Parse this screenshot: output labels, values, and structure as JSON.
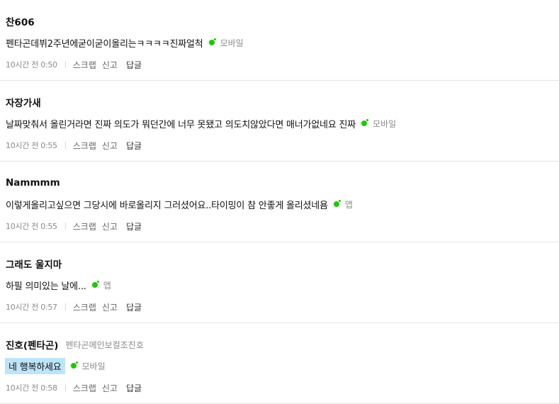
{
  "comments": [
    {
      "author": "찬606",
      "author_sub": "",
      "text": "펜타곤데뷔2주년에굳이굳이올리는ㅋㅋㅋㅋ진짜얼척",
      "highlight": false,
      "device": "모바일",
      "timestamp": "10시간 전 0:50",
      "actions": {
        "scrap": "스크랩",
        "report": "신고",
        "reply": "답글"
      }
    },
    {
      "author": "자장가새",
      "author_sub": "",
      "text": "날짜맞춰서 올린거라면 진짜 의도가 뭐던간에 너무 못됐고 의도치않았다면 매너가없네요 진짜",
      "highlight": false,
      "device": "모바일",
      "timestamp": "10시간 전 0:55",
      "actions": {
        "scrap": "스크랩",
        "report": "신고",
        "reply": "답글"
      }
    },
    {
      "author": "Nammmm",
      "author_sub": "",
      "text": "이렇게올리고싶으면 그당시에 바로올리지 그러셨어요..타이밍이 참 안좋게 올리셨네욤",
      "highlight": false,
      "device": "앱",
      "timestamp": "10시간 전 0:55",
      "actions": {
        "scrap": "스크랩",
        "report": "신고",
        "reply": "답글"
      }
    },
    {
      "author": "그래도 울지마",
      "author_sub": "",
      "text": "하필 의미있는 날에...",
      "highlight": false,
      "device": "앱",
      "timestamp": "10시간 전 0:57",
      "actions": {
        "scrap": "스크랩",
        "report": "신고",
        "reply": "답글"
      }
    },
    {
      "author": "진호(펜타곤)",
      "author_sub": "펜타곤메인보컬조진호",
      "text": "네 행복하세요",
      "highlight": true,
      "device": "모바일",
      "timestamp": "10시간 전 0:58",
      "actions": {
        "scrap": "스크랩",
        "report": "신고",
        "reply": "답글"
      }
    }
  ],
  "colors": {
    "device_dot": "#1ec800",
    "highlight_bg": "#bde4f8",
    "meta_text": "#8a8a8a"
  },
  "icons": {
    "device": "green-dot-icon"
  }
}
